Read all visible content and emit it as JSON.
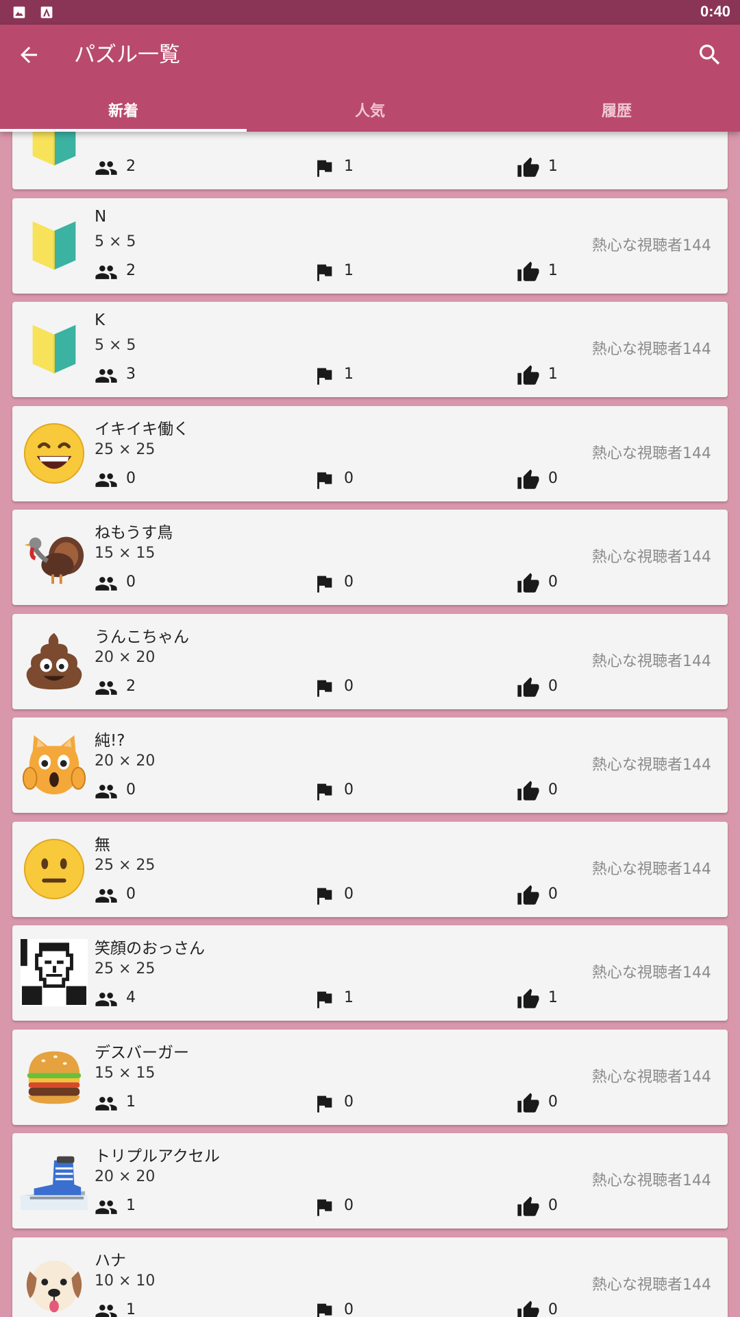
{
  "status_bar": {
    "time": "0:40"
  },
  "app_bar": {
    "title": "パズル一覧"
  },
  "tabs": [
    {
      "label": "新着",
      "active": true
    },
    {
      "label": "人気",
      "active": false
    },
    {
      "label": "履歴",
      "active": false
    }
  ],
  "puzzles": [
    {
      "title": "",
      "size": "",
      "author": "",
      "players": "2",
      "clears": "1",
      "likes": "1",
      "thumb": "beginner-mark-icon"
    },
    {
      "title": "N",
      "size": "5 × 5",
      "author": "熱心な視聴者144",
      "players": "2",
      "clears": "1",
      "likes": "1",
      "thumb": "beginner-mark-icon"
    },
    {
      "title": "K",
      "size": "5 × 5",
      "author": "熱心な視聴者144",
      "players": "3",
      "clears": "1",
      "likes": "1",
      "thumb": "beginner-mark-icon"
    },
    {
      "title": "イキイキ働く",
      "size": "25 × 25",
      "author": "熱心な視聴者144",
      "players": "0",
      "clears": "0",
      "likes": "0",
      "thumb": "grinning-face-icon"
    },
    {
      "title": "ねもうす鳥",
      "size": "15 × 15",
      "author": "熱心な視聴者144",
      "players": "0",
      "clears": "0",
      "likes": "0",
      "thumb": "turkey-icon"
    },
    {
      "title": "うんこちゃん",
      "size": "20 × 20",
      "author": "熱心な視聴者144",
      "players": "2",
      "clears": "0",
      "likes": "0",
      "thumb": "poop-icon"
    },
    {
      "title": "純!?",
      "size": "20 × 20",
      "author": "熱心な視聴者144",
      "players": "0",
      "clears": "0",
      "likes": "0",
      "thumb": "weary-cat-icon"
    },
    {
      "title": "無",
      "size": "25 × 25",
      "author": "熱心な視聴者144",
      "players": "0",
      "clears": "0",
      "likes": "0",
      "thumb": "neutral-face-icon"
    },
    {
      "title": "笑顔のおっさん",
      "size": "25 × 25",
      "author": "熱心な視聴者144",
      "players": "4",
      "clears": "1",
      "likes": "1",
      "thumb": "pixel-portrait-icon"
    },
    {
      "title": "デスバーガー",
      "size": "15 × 15",
      "author": "熱心な視聴者144",
      "players": "1",
      "clears": "0",
      "likes": "0",
      "thumb": "hamburger-icon"
    },
    {
      "title": "トリプルアクセル",
      "size": "20 × 20",
      "author": "熱心な視聴者144",
      "players": "1",
      "clears": "0",
      "likes": "0",
      "thumb": "ice-skate-icon"
    },
    {
      "title": "ハナ",
      "size": "10 × 10",
      "author": "熱心な視聴者144",
      "players": "1",
      "clears": "0",
      "likes": "0",
      "thumb": "dog-face-icon"
    }
  ]
}
